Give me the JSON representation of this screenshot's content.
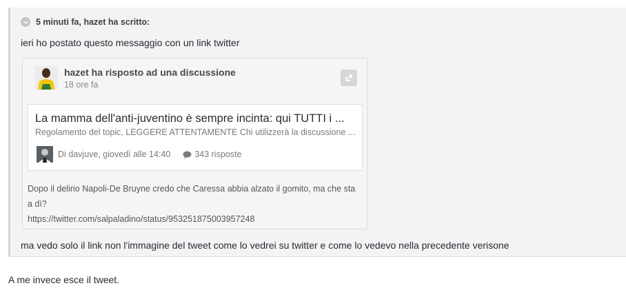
{
  "quote": {
    "citation": "5 minuti fa, hazet ha scritto:",
    "line1": "ieri ho postato questo messaggio con un link twitter",
    "line2": "ma vedo solo il link non l'immagine del tweet come lo vedrei su twitter e come lo vedevo nella precedente verisone"
  },
  "embed": {
    "title": "hazet ha risposto ad una discussione",
    "time": "18 ore fa",
    "topic": {
      "title": "La mamma dell'anti-juventino è sempre incinta: qui TUTTI i ...",
      "snippet": "Regolamento del topic, LEGGERE ATTENTAMENTE Chi utilizzerà la discussione ...",
      "meta": "Di davjuve, giovedì alle 14:40",
      "replies": "343 risposte"
    },
    "body_line1": "Dopo il delirio Napoli-De Bruyne credo che Caressa abbia alzato il gomito, ma che sta",
    "body_line2": "a dì?",
    "body_link": "https://twitter.com/salpaladino/status/953251875003957248"
  },
  "reply": {
    "text": "A me invece esce il tweet."
  },
  "colors": {
    "quote_bg": "#f3f3f3",
    "embed_bg": "#f5f5f5",
    "card_bg": "#ffffff"
  }
}
